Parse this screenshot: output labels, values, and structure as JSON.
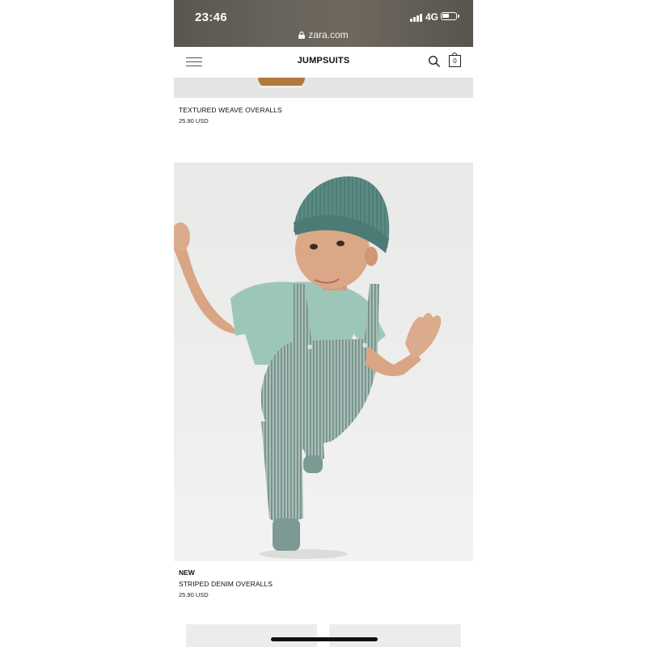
{
  "status_bar": {
    "time": "23:46",
    "url": "zara.com",
    "network": "4G"
  },
  "header": {
    "title": "JUMPSUITS",
    "cart_count": "0"
  },
  "products": [
    {
      "name": "TEXTURED WEAVE OVERALLS",
      "price": "25.90 USD"
    },
    {
      "badge": "NEW",
      "name": "STRIPED DENIM OVERALLS",
      "price": "25.90 USD"
    }
  ],
  "colors": {
    "status_bar_bg": "#625e57",
    "beanie": "#5a8a84",
    "tshirt": "#9cc7b8",
    "overalls": "#8fa9a2"
  },
  "icons": [
    "lock-icon",
    "signal-icon",
    "battery-icon",
    "menu-icon",
    "search-icon",
    "bag-icon"
  ]
}
